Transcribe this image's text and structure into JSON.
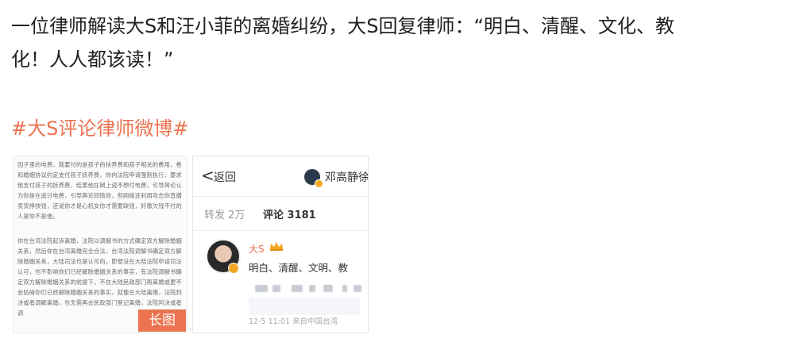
{
  "post": {
    "line1": "一位律师解读大S和汪小菲的离婚纠纷，大S回复律师：“明白、清醒、文化、教",
    "line2": "化！人人都该读！”",
    "hashtag": "#大S评论律师微博#"
  },
  "long_image": {
    "paragraph1": "因子里的电费，我要付的是孩子的扶养费和孩子相关的费用，卷和婚姻协议约定支付孩子抚养费，你向法院申请强制执行，要求他支付孩子的抚养费，结果他在网上说不想付电费，引导舆论认为你是在追讨电费，引导舆论同情你，但网络还利用攻击你直播卖货挣快钱，还说你才是心机女你才需要缺钱，好像欠钱不付的人是你不是他。",
    "paragraph2": "你在台湾法院起诉离婚，法院以调解书的方式确定双方解除婚姻关系，然后你在台湾离婚完全合法，台湾法院调解书确定双方解除婚姻关系，大陆司法也是认可的，即便没在大陆法院申请司法认可，也不影响你们已经解除婚姻关系的事实，有法院调解书确定双方解除婚姻关系的前提下，不在大陆民政部门再离婚或更不会妨碍你们已经解除婚姻关系的事实，就像在大陆离婚，法院判决或者调解离婚，也无需再去民政部门登记离婚，法院判决或者调",
    "badge": "长图"
  },
  "screenshot": {
    "back_arrow": "<",
    "back_label": "返回",
    "top_user": "邓高静徐",
    "tab_repost": "转发 2万",
    "tab_comment": "评论 3181",
    "comment": {
      "name": "大S",
      "text": "明白、清醒、文明、教",
      "meta": "12-5 11:01 来自中国台湾"
    }
  },
  "colors": {
    "accent": "#eb7350",
    "text": "#222222",
    "vip": "#f5a623"
  }
}
